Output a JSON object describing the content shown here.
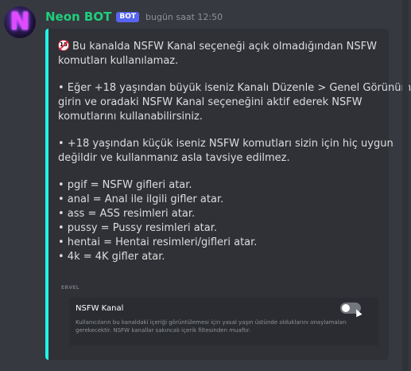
{
  "message": {
    "username": "Neon BOT",
    "bot_badge": "BOT",
    "timestamp": "bugün saat 12:50",
    "avatar_letter": "N"
  },
  "embed": {
    "accent_color": "#21f5e7",
    "age_badge": "18",
    "para1": [
      "Bu kanalda NSFW Kanal seçeneği açık olmadığından NSFW",
      "komutları kullanılamaz."
    ],
    "para2": [
      "• Eğer +18 yaşından büyük iseniz Kanalı Düzenle > Genel Görünüm'e",
      "girin ve oradaki NSFW Kanal seçeneğini aktif ederek NSFW",
      "komutlarını kullanabilirsiniz."
    ],
    "para3": [
      "• +18 yaşından küçük iseniz NSFW komutları sizin için hiç uygun",
      "değildir ve kullanmanız asla tavsiye edilmez."
    ],
    "commands": [
      "• pgif = NSFW gifleri atar.",
      "• anal = Anal ile ilgili gifler atar.",
      "• ass = ASS resimleri atar.",
      "• pussy = Pussy resimleri atar.",
      "• hentai = Hentai resimleri/gifleri atar.",
      "• 4k = 4K gifler atar."
    ],
    "screenshot": {
      "header": "ERVEL",
      "title": "NSFW Kanal",
      "desc_lines": [
        "Kullanıcıların bu kanaldaki içeriği görüntülemesi için yasal yaşın üstünde olduklarını onaylamaları",
        "gerekecektir. NSFW kanallar sakıncalı içerik filtesinden muaftır."
      ],
      "toggle_on": false
    }
  }
}
